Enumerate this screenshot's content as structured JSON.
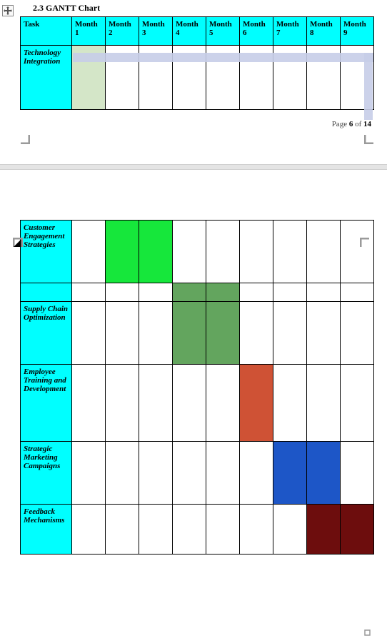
{
  "heading": "2.3 GANTT Chart",
  "columns": [
    "Task",
    "Month 1",
    "Month 2",
    "Month 3",
    "Month 4",
    "Month 5",
    "Month 6",
    "Month 7",
    "Month 8",
    "Month 9"
  ],
  "page_label_prefix": "Page ",
  "page_current": "6",
  "page_label_mid": " of ",
  "page_total": "14",
  "move_icon_name": "move-icon",
  "chart_data": {
    "type": "gantt-table",
    "tasks": [
      {
        "name": "Technology Integration",
        "months": [
          1
        ],
        "color": "#d4e6c8"
      },
      {
        "name": "Customer Engagement Strategies",
        "months": [
          2,
          3
        ],
        "color": "#16e73b"
      },
      {
        "name": "",
        "months": [
          4,
          5
        ],
        "color": "#63a55e"
      },
      {
        "name": "Supply Chain Optimization",
        "months": [
          4,
          5
        ],
        "color": "#63a55e"
      },
      {
        "name": "Employee Training and Development",
        "months": [
          6
        ],
        "color": "#cf5235"
      },
      {
        "name": "Strategic Marketing Campaigns",
        "months": [
          7,
          8
        ],
        "color": "#1d56c7"
      },
      {
        "name": "Feedback Mechanisms",
        "months": [
          8,
          9
        ],
        "color": "#6d0d0d"
      }
    ],
    "month_count": 9
  }
}
